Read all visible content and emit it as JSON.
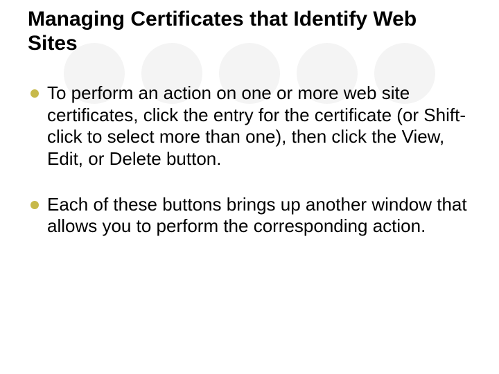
{
  "title": "Managing Certificates that Identify Web Sites",
  "bullets": [
    "To perform an action on one or more web site certificates, click the entry for the certificate (or Shift-click to select more than one), then click the View, Edit, or Delete button.",
    "Each of these buttons brings up another window that allows you to perform the corresponding action."
  ]
}
